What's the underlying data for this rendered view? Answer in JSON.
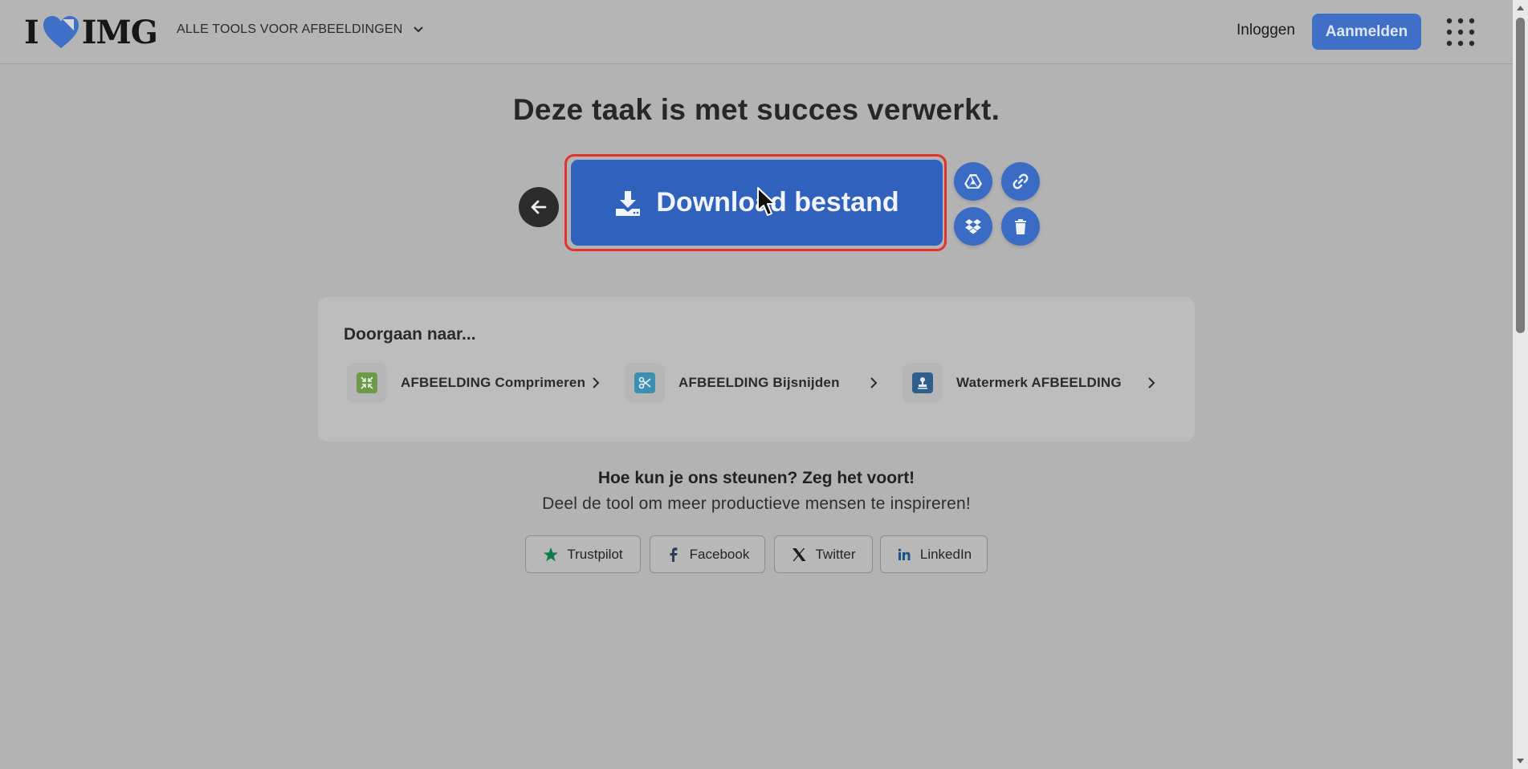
{
  "header": {
    "logo_text_left": "I",
    "logo_text_right": "IMG",
    "tools_menu_label": "ALLE TOOLS VOOR AFBEELDINGEN",
    "login_label": "Inloggen",
    "signup_label": "Aanmelden"
  },
  "main": {
    "title": "Deze taak is met succes verwerkt.",
    "download_label": "Download bestand"
  },
  "continue": {
    "title": "Doorgaan naar...",
    "items": [
      {
        "label": "AFBEELDING Comprimeren",
        "icon": "compress-icon",
        "color": "#6d9a4a"
      },
      {
        "label": "AFBEELDING Bijsnijden",
        "icon": "crop-icon",
        "color": "#3c8fb0"
      },
      {
        "label": "Watermerk AFBEELDING",
        "icon": "stamp-icon",
        "color": "#2f5f8a"
      }
    ]
  },
  "support": {
    "title": "Hoe kun je ons steunen? Zeg het voort!",
    "subtitle": "Deel de tool om meer productieve mensen te inspireren!",
    "buttons": [
      {
        "label": "Trustpilot",
        "icon": "trustpilot-star-icon"
      },
      {
        "label": "Facebook",
        "icon": "facebook-icon"
      },
      {
        "label": "Twitter",
        "icon": "x-icon"
      },
      {
        "label": "LinkedIn",
        "icon": "linkedin-icon"
      }
    ]
  },
  "colors": {
    "accent": "#2f61bd",
    "highlight": "#e0322e",
    "logo_heart": "#3f6fc6"
  }
}
